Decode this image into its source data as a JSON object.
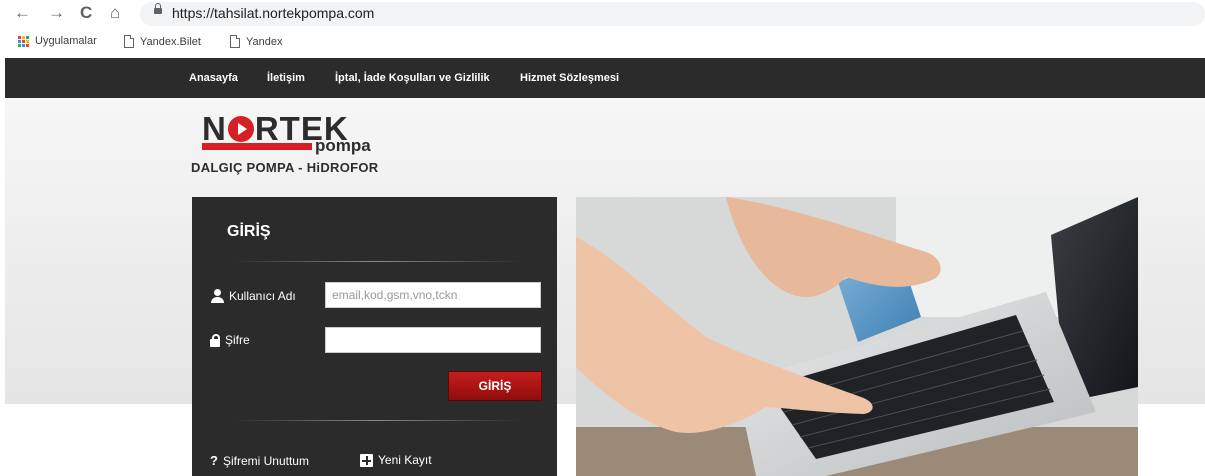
{
  "browser": {
    "url": "https://tahsilat.nortekpompa.com",
    "bookmarks": [
      "Uygulamalar",
      "Yandex.Bilet",
      "Yandex"
    ]
  },
  "nav": {
    "items": [
      "Anasayfa",
      "İletişim",
      "İptal, İade Koşulları ve Gizlilik",
      "Hizmet Sözleşmesi"
    ]
  },
  "logo": {
    "brand_pre": "N",
    "brand_post": "RTEK",
    "sub": "pompa",
    "tagline": "DALGIÇ POMPA - HiDROFOR"
  },
  "login": {
    "title": "GİRİŞ",
    "username_label": "Kullanıcı Adı",
    "username_placeholder": "email,kod,gsm,vno,tckn",
    "username_value": "",
    "password_label": "Şifre",
    "password_value": "",
    "submit_label": "GİRİŞ",
    "forgot_label": "Şifremi Unuttum",
    "register_label": "Yeni Kayıt"
  },
  "colors": {
    "nav_bg": "#2b2b2b",
    "brand_red": "#d71f26",
    "button_red": "#b31818"
  },
  "icons": [
    "back-icon",
    "forward-icon",
    "reload-icon",
    "home-icon",
    "lock-icon",
    "apps-icon",
    "page-icon",
    "user-icon",
    "padlock-icon",
    "question-icon",
    "plus-icon"
  ]
}
